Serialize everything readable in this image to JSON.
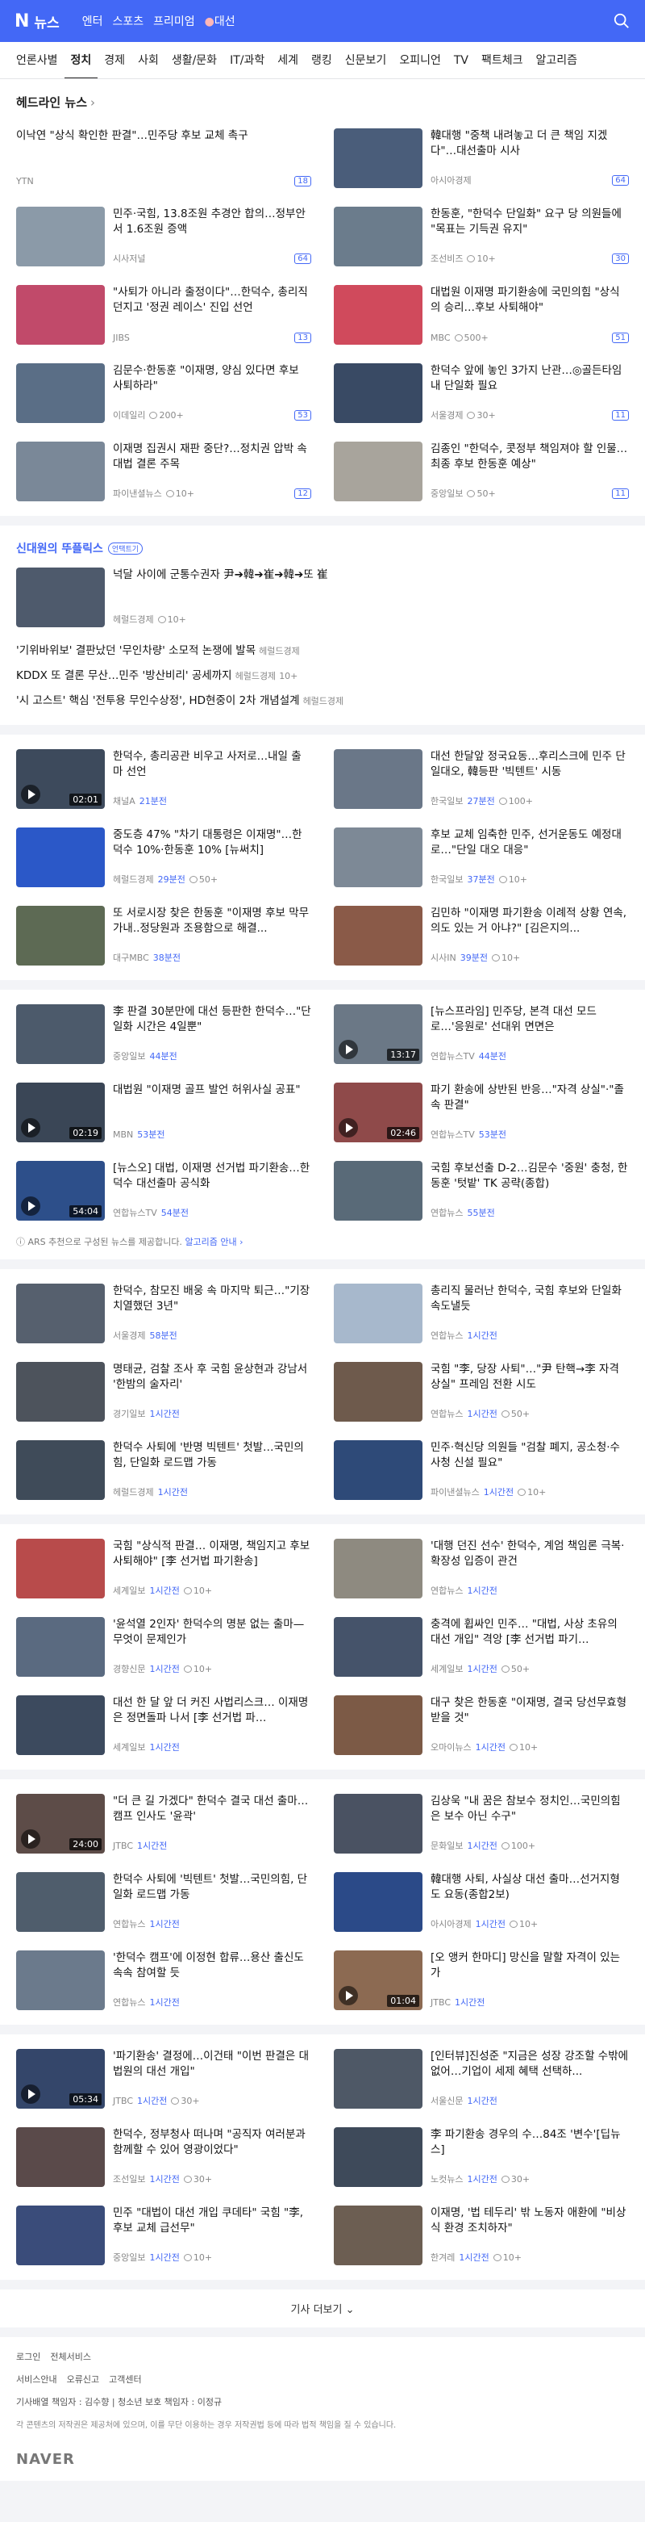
{
  "header": {
    "logo_n": "N",
    "logo_text": "뉴스",
    "links": [
      "엔터",
      "스포츠",
      "프리미엄"
    ],
    "live": "대선"
  },
  "categories": [
    "언론사별",
    "정치",
    "경제",
    "사회",
    "생활/문화",
    "IT/과학",
    "세계",
    "랭킹",
    "신문보기",
    "오피니언",
    "TV",
    "팩트체크",
    "알고리즘"
  ],
  "headline": {
    "title": "헤드라인 뉴스",
    "arrow": "›",
    "first": {
      "title": "이낙연 \"상식 확인한 판결\"…민주당 후보 교체 촉구",
      "source": "YTN",
      "badge": "18"
    },
    "items": [
      {
        "title": "韓대행 \"중책 내려놓고 더 큰 책임 지겠다\"…대선출마 시사",
        "source": "아시아경제",
        "badge": "64",
        "thumb": "#4a5d7a"
      },
      {
        "title": "민주·국힘, 13.8조원 추경안 합의…정부안서 1.6조원 증액",
        "source": "시사저널",
        "badge": "64",
        "thumb": "#8b9aa8"
      },
      {
        "title": "한동훈, \"한덕수 단일화\" 요구 당 의원들에 \"목표는 기득권 유지\"",
        "source": "조선비즈",
        "comment": "10+",
        "badge": "30",
        "thumb": "#6b7c8c"
      },
      {
        "title": "\"사퇴가 아니라 출정이다\"…한덕수, 총리직 던지고 '정권 레이스' 진입 선언",
        "source": "JIBS",
        "badge": "13",
        "thumb": "#c14a6a"
      },
      {
        "title": "대법원 이재명 파기환송에 국민의힘 \"상식의 승리…후보 사퇴해야\"",
        "source": "MBC",
        "comment": "500+",
        "badge": "51",
        "thumb": "#d04a5c"
      },
      {
        "title": "김문수·한동훈 \"이재명, 양심 있다면 후보 사퇴하라\"",
        "source": "이데일리",
        "comment": "200+",
        "badge": "53",
        "thumb": "#5a6e86"
      },
      {
        "title": "한덕수 앞에 놓인 3가지 난관…◎골든타임 내 단일화 필요",
        "source": "서울경제",
        "comment": "30+",
        "badge": "11",
        "thumb": "#394a64"
      },
      {
        "title": "이재명 집권시 재판 중단?…정치권 압박 속 대법 결론 주목",
        "source": "파이낸셜뉴스",
        "comment": "10+",
        "badge": "12",
        "thumb": "#7a8898"
      },
      {
        "title": "김종인 \"한덕수, 콧정부 책임져야 할 인물…최종 후보 한동훈 예상\"",
        "source": "중앙일보",
        "comment": "50+",
        "badge": "11",
        "thumb": "#a8a49c"
      }
    ]
  },
  "special": {
    "title": "신대원의 뚜플릭스",
    "tag": "언택트기",
    "lead": {
      "title": "넉달 사이에 군통수권자 尹➔韓➔崔➔韓➔또 崔",
      "source": "헤럴드경제",
      "comment": "10+"
    },
    "lines": [
      {
        "title": "'기위바위보' 결판났던 '무인차량' 소모적 논쟁에 발목",
        "source": "헤럴드경제",
        "comment": ""
      },
      {
        "title": "KDDX 또 결론 무산…민주 '방산비리' 공세까지",
        "source": "헤럴드경제",
        "comment": "10+"
      },
      {
        "title": "'시 고스트' 핵심 '전투용 무인수상정', HD현중이 2차 개념설계",
        "source": "헤럴드경제",
        "comment": ""
      }
    ]
  },
  "group1": [
    {
      "title": "한덕수, 총리공관 비우고 사저로…내일 출마 선언",
      "source": "채널A",
      "time": "21분전",
      "video": "02:01",
      "thumb": "#3d4a5c"
    },
    {
      "title": "대선 한달앞 정국요동…후리스크에 민주 단일대오, 韓등판 '빅텐트' 시동",
      "source": "한국일보",
      "time": "27분전",
      "comment": "100+",
      "thumb": "#6a7788"
    },
    {
      "title": "중도층 47% \"차기 대통령은 이재명\"…한덕수 10%·한동훈 10% [뉴써치]",
      "source": "헤럴드경제",
      "time": "29분전",
      "comment": "50+",
      "thumb": "#2b58c8"
    },
    {
      "title": "후보 교체 임축한 민주, 선거운동도 예정대로…\"단일 대오 대응\"",
      "source": "한국일보",
      "time": "37분전",
      "comment": "10+",
      "thumb": "#7d8996"
    },
    {
      "title": "또 서로시장 찾은 한동훈 \"이재명 후보 막무가내..정당원과 조용함으로 해결...",
      "source": "대구MBC",
      "time": "38분전",
      "thumb": "#5d6a54"
    },
    {
      "title": "김민하 \"이재명 파기환송 이례적 상황 연속, 의도 있는 거 아냐?\" [김은지의...",
      "source": "시사IN",
      "time": "39분전",
      "comment": "10+",
      "thumb": "#8a5a48"
    }
  ],
  "group2": [
    {
      "title": "李 판결 30분만에 대선 등판한 한덕수…\"단일화 시간은 4일뿐\"",
      "source": "중앙일보",
      "time": "44분전",
      "thumb": "#4c5a6b"
    },
    {
      "title": "[뉴스프라임] 민주당, 본격 대선 모드로…'응원로' 선대위 면면은",
      "source": "연합뉴스TV",
      "time": "44분전",
      "video": "13:17",
      "thumb": "#6b7886"
    },
    {
      "title": "대법원 \"이재명 골프 발언 허위사실 공표\"",
      "source": "MBN",
      "time": "53분전",
      "video": "02:19",
      "thumb": "#3a4656"
    },
    {
      "title": "파기 환송에 상반된 반응…\"자격 상실\"·\"졸속 판결\"",
      "source": "연합뉴스TV",
      "time": "53분전",
      "video": "02:46",
      "thumb": "#8f4a4a"
    },
    {
      "title": "[뉴스오] 대법, 이재명 선거법 파기환송…한덕수 대선출마 공식화",
      "source": "연합뉴스TV",
      "time": "54분전",
      "video": "54:04",
      "thumb": "#2d4f8a"
    },
    {
      "title": "국힘 후보선출 D-2…김문수 '중원' 충청, 한동훈 '텃밭' TK 공략(종합)",
      "source": "연합뉴스",
      "time": "55분전",
      "thumb": "#596a78"
    }
  ],
  "ars": {
    "text": "ARS 추천으로 구성된 뉴스를 제공합니다.",
    "link": "알고리즘 안내 ›"
  },
  "group3": [
    {
      "title": "한덕수, 참모진 배웅 속 마지막 퇴근…\"기장 치열했던 3년\"",
      "source": "서울경제",
      "time": "58분전",
      "thumb": "#56606e"
    },
    {
      "title": "총리직 물러난 한덕수, 국힘 후보와 단일화 속도낼듯",
      "source": "연합뉴스",
      "time": "1시간전",
      "thumb": "#a7b8cc"
    },
    {
      "title": "명태균, 검찰 조사 후 국힘 윤상현과 강남서 '한밤의 술자리'",
      "source": "경기일보",
      "time": "1시간전",
      "thumb": "#4d535c"
    },
    {
      "title": "국힘 \"李, 당장 사퇴\"…\"尹 탄핵→李 자격상실\" 프레임 전환 시도",
      "source": "연합뉴스",
      "time": "1시간전",
      "comment": "50+",
      "thumb": "#6e5a4c"
    },
    {
      "title": "한덕수 사퇴에 '반명 빅텐트' 첫발…국민의힘, 단일화 로드맵 가동",
      "source": "헤럴드경제",
      "time": "1시간전",
      "thumb": "#3f4b59"
    },
    {
      "title": "민주·혁신당 의원들 \"검찰 폐지, 공소청·수사청 신설 필요\"",
      "source": "파이낸셜뉴스",
      "time": "1시간전",
      "comment": "10+",
      "thumb": "#2e4a78"
    }
  ],
  "group4": [
    {
      "title": "국힘 \"상식적 판결… 이재명, 책임지고 후보 사퇴해야\" [李 선거법 파기환송]",
      "source": "세계일보",
      "time": "1시간전",
      "comment": "10+",
      "thumb": "#b84b4b"
    },
    {
      "title": "'대행 던진 선수' 한덕수, 계엄 책임론 극복·확장성 입증이 관건",
      "source": "연합뉴스",
      "time": "1시간전",
      "thumb": "#8e8a80"
    },
    {
      "title": "'윤석열 2인자' 한덕수의 명분 없는 출마—무엇이 문제인가",
      "source": "경향신문",
      "time": "1시간전",
      "comment": "10+",
      "thumb": "#5a6a80"
    },
    {
      "title": "충격에 휩싸인 민주… \"대법, 사상 초유의 대선 개입\" 격앙 [李 선거법 파기…",
      "source": "세계일보",
      "time": "1시간전",
      "comment": "50+",
      "thumb": "#45536a"
    },
    {
      "title": "대선 한 달 앞 더 커진 사법리스크… 이재명은 정면돌파 나서 [李 선거법 파…",
      "source": "세계일보",
      "time": "1시간전",
      "thumb": "#3c4a5e"
    },
    {
      "title": "대구 찾은 한동훈 \"이재명, 결국 당선무효형 받을 것\"",
      "source": "오마이뉴스",
      "time": "1시간전",
      "comment": "10+",
      "thumb": "#7c5a46"
    }
  ],
  "group5": [
    {
      "title": "\"더 큰 길 가겠다\" 한덕수 결국 대선 출마…캠프 인사도 '윤곽'",
      "source": "JTBC",
      "time": "1시간전",
      "video": "24:00",
      "thumb": "#5d4c48"
    },
    {
      "title": "김상욱 \"내 꿈은 참보수 정치인…국민의힘은 보수 아닌 수구\"",
      "source": "문화일보",
      "time": "1시간전",
      "comment": "100+",
      "thumb": "#4a5262"
    },
    {
      "title": "한덕수 사퇴에 '빅텐트' 첫발…국민의힘, 단일화 로드맵 가동",
      "source": "연합뉴스",
      "time": "1시간전",
      "thumb": "#4f5d6c"
    },
    {
      "title": "韓대행 사퇴, 사실상 대선 출마…선거지형도 요동(종합2보)",
      "source": "아시아경제",
      "time": "1시간전",
      "comment": "10+",
      "thumb": "#2b4a88"
    },
    {
      "title": "'한덕수 캠프'에 이정현 합류…용산 출신도 속속 참여할 듯",
      "source": "연합뉴스",
      "time": "1시간전",
      "thumb": "#6b7a8c"
    },
    {
      "title": "[오 앵커 한마디] 망신을 말할 자격이 있는가",
      "source": "JTBC",
      "time": "1시간전",
      "video": "01:04",
      "thumb": "#8c6a52"
    }
  ],
  "group6": [
    {
      "title": "'파기환송' 결정에…이건태 \"이번 판결은 대법원의 대선 개입\"",
      "source": "JTBC",
      "time": "1시간전",
      "comment": "30+",
      "video": "05:34",
      "thumb": "#34466a"
    },
    {
      "title": "[인터뷰]진성준 \"지금은 성장 강조할 수밖에 없어…기업이 세제 혜택 선택하...",
      "source": "서울신문",
      "time": "1시간전",
      "thumb": "#4e5866"
    },
    {
      "title": "한덕수, 정부청사 떠나며 \"공직자 여러분과 함께할 수 있어 영광이었다\"",
      "source": "조선일보",
      "time": "1시간전",
      "comment": "30+",
      "thumb": "#5a4a4a"
    },
    {
      "title": "李 파기환송 경우의 수…84조 '변수'[딥뉴스]",
      "source": "노컷뉴스",
      "time": "1시간전",
      "comment": "30+",
      "thumb": "#3e4a5a"
    },
    {
      "title": "민주 \"대법이 대선 개입 쿠데타\" 국힘 \"李, 후보 교체 급선무\"",
      "source": "중앙일보",
      "time": "1시간전",
      "comment": "10+",
      "thumb": "#3a4c7a"
    },
    {
      "title": "이재명, '법 테두리' 밖 노동자 애환에 \"비상식 환경 조치하자\"",
      "source": "한겨레",
      "time": "1시간전",
      "comment": "10+",
      "thumb": "#6c5e52"
    }
  ],
  "more": "기사 더보기 ⌄",
  "footer": {
    "row1": [
      "로그인",
      "전체서비스"
    ],
    "row2": [
      "서비스안내",
      "오류신고",
      "고객센터"
    ],
    "row3": "기사배열 책임자 : 김수향  |  청소년 보호 책임자 : 이정규",
    "copy": "각 콘텐츠의 저작권은 제공처에 있으며, 이를 무단 이용하는 경우 저작권법 등에 따라 법적 책임을 질 수 있습니다.",
    "brand": "NAVER"
  }
}
